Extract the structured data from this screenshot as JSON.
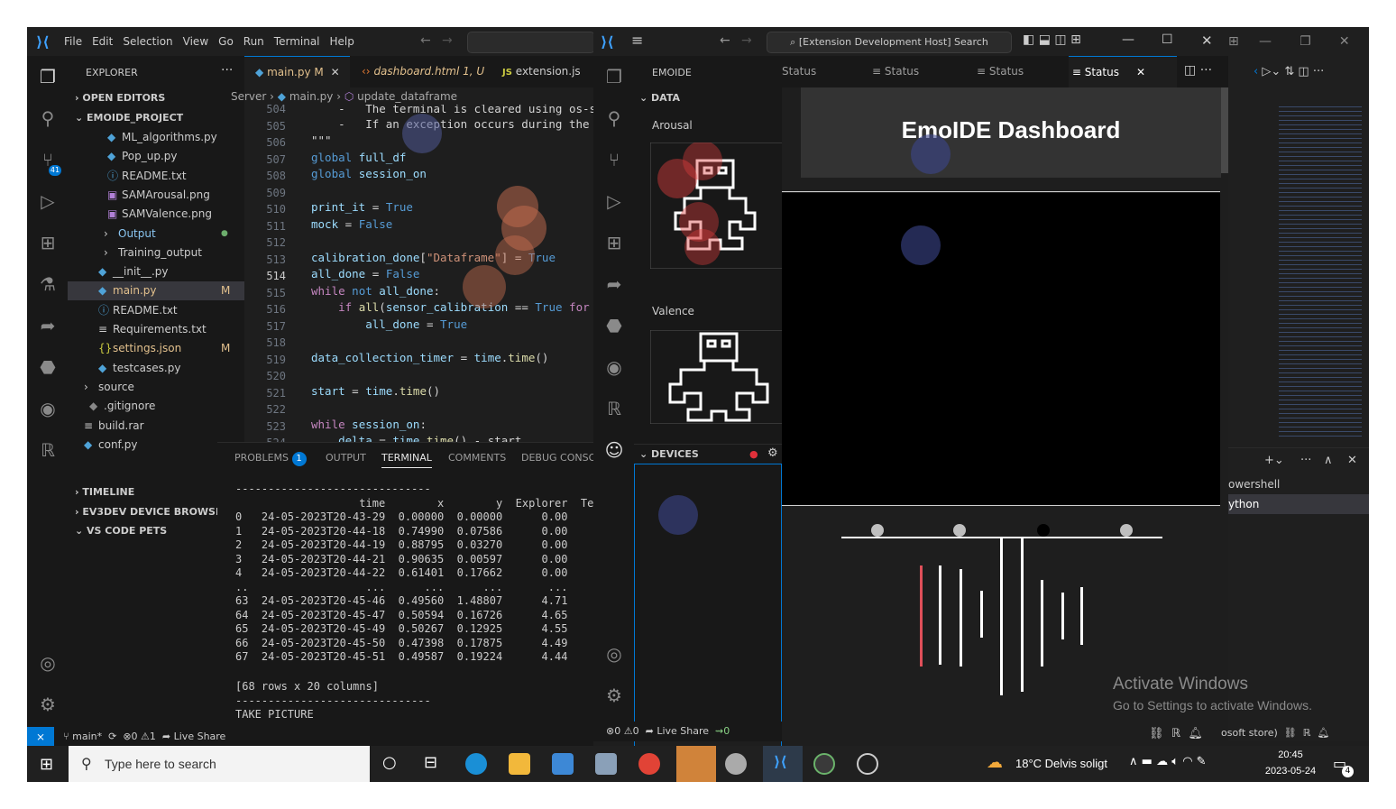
{
  "colors": {
    "accent": "#0078d4",
    "bg": "#1e1e1e",
    "sidebar": "#181818",
    "red": "#e0505a"
  },
  "vscode": {
    "menu": [
      "File",
      "Edit",
      "Selection",
      "View",
      "Go",
      "Run",
      "Terminal",
      "Help"
    ],
    "explorer": {
      "title": "EXPLORER",
      "sections": {
        "open_editors": "OPEN EDITORS",
        "project": "EMOIDE_PROJECT",
        "timeline": "TIMELINE",
        "ev3dev": "EV3DEV DEVICE BROWSER",
        "pets": "VS CODE PETS"
      },
      "files": [
        {
          "name": "ML_algorithms.py",
          "badge": ""
        },
        {
          "name": "Pop_up.py",
          "badge": ""
        },
        {
          "name": "README.txt",
          "badge": ""
        },
        {
          "name": "SAMArousal.png",
          "badge": ""
        },
        {
          "name": "SAMValence.png",
          "badge": ""
        },
        {
          "name": "Output",
          "badge": "●"
        },
        {
          "name": "Training_output",
          "badge": ""
        },
        {
          "name": "__init__.py",
          "badge": ""
        },
        {
          "name": "main.py",
          "badge": "M"
        },
        {
          "name": "README.txt",
          "badge": ""
        },
        {
          "name": "Requirements.txt",
          "badge": ""
        },
        {
          "name": "settings.json",
          "badge": "M"
        },
        {
          "name": "testcases.py",
          "badge": ""
        },
        {
          "name": "source",
          "badge": ""
        },
        {
          "name": ".gitignore",
          "badge": ""
        },
        {
          "name": "build.rar",
          "badge": ""
        },
        {
          "name": "conf.py",
          "badge": ""
        }
      ]
    },
    "tabs": [
      {
        "label": "main.py",
        "mod": "M"
      },
      {
        "label": "dashboard.html",
        "mod": "1, U"
      },
      {
        "label": "extension.js",
        "mod": ""
      }
    ],
    "breadcrumb": {
      "a": "Server",
      "b": "main.py",
      "c": "update_dataframe"
    },
    "line_numbers": [
      "504",
      "505",
      "506",
      "507",
      "508",
      "509",
      "510",
      "511",
      "512",
      "513",
      "514",
      "515",
      "516",
      "517",
      "518",
      "519",
      "520",
      "521",
      "522",
      "523",
      "524"
    ],
    "panel_tabs": {
      "problems": "PROBLEMS",
      "problems_count": "1",
      "output": "OUTPUT",
      "terminal": "TERMINAL",
      "comments": "COMMENTS",
      "debug": "DEBUG CONSOL"
    },
    "terminal_lines": [
      "------------------------------",
      "                   time        x        y  Explorer  Term",
      "0   24-05-2023T20-43-29  0.00000  0.00000      0.00",
      "1   24-05-2023T20-44-18  0.74990  0.07586      0.00",
      "2   24-05-2023T20-44-19  0.88795  0.03270      0.00",
      "3   24-05-2023T20-44-21  0.90635  0.00597      0.00",
      "4   24-05-2023T20-44-22  0.61401  0.17662      0.00",
      "..                  ...      ...      ...       ...",
      "63  24-05-2023T20-45-46  0.49560  1.48807      4.71",
      "64  24-05-2023T20-45-47  0.50594  0.16726      4.65",
      "65  24-05-2023T20-45-49  0.50267  0.12925      4.55",
      "66  24-05-2023T20-45-50  0.47398  0.17875      4.49",
      "67  24-05-2023T20-45-51  0.49587  0.19224      4.44",
      "",
      "[68 rows x 20 columns]",
      "------------------------------",
      "TAKE PICTURE"
    ],
    "status": {
      "branch": "main*",
      "errors": "0",
      "warnings": "1",
      "live_share": "Live Share"
    }
  },
  "devhost": {
    "search": "[Extension Development Host] Search",
    "emoide_title": "EMOIDE",
    "data_section": "DATA",
    "arousal": "Arousal",
    "valence": "Valence",
    "devices_section": "DEVICES",
    "tabs": [
      "Status",
      "Status",
      "Status",
      "Status"
    ],
    "dashboard_title": "EmoIDE Dashboard",
    "status_errors": "0",
    "status_warnings": "0",
    "live_share": "Live Share",
    "ports": "0"
  },
  "right_panel": {
    "shells": [
      "owershell",
      "ython"
    ]
  },
  "watermark": {
    "title": "Activate Windows",
    "sub": "Go to Settings to activate Windows."
  },
  "status_partial": "osoft store)",
  "taskbar": {
    "search_placeholder": "Type here to search",
    "weather": "18°C  Delvis soligt",
    "time": "20:45",
    "date": "2023-05-24",
    "notif": "4"
  }
}
